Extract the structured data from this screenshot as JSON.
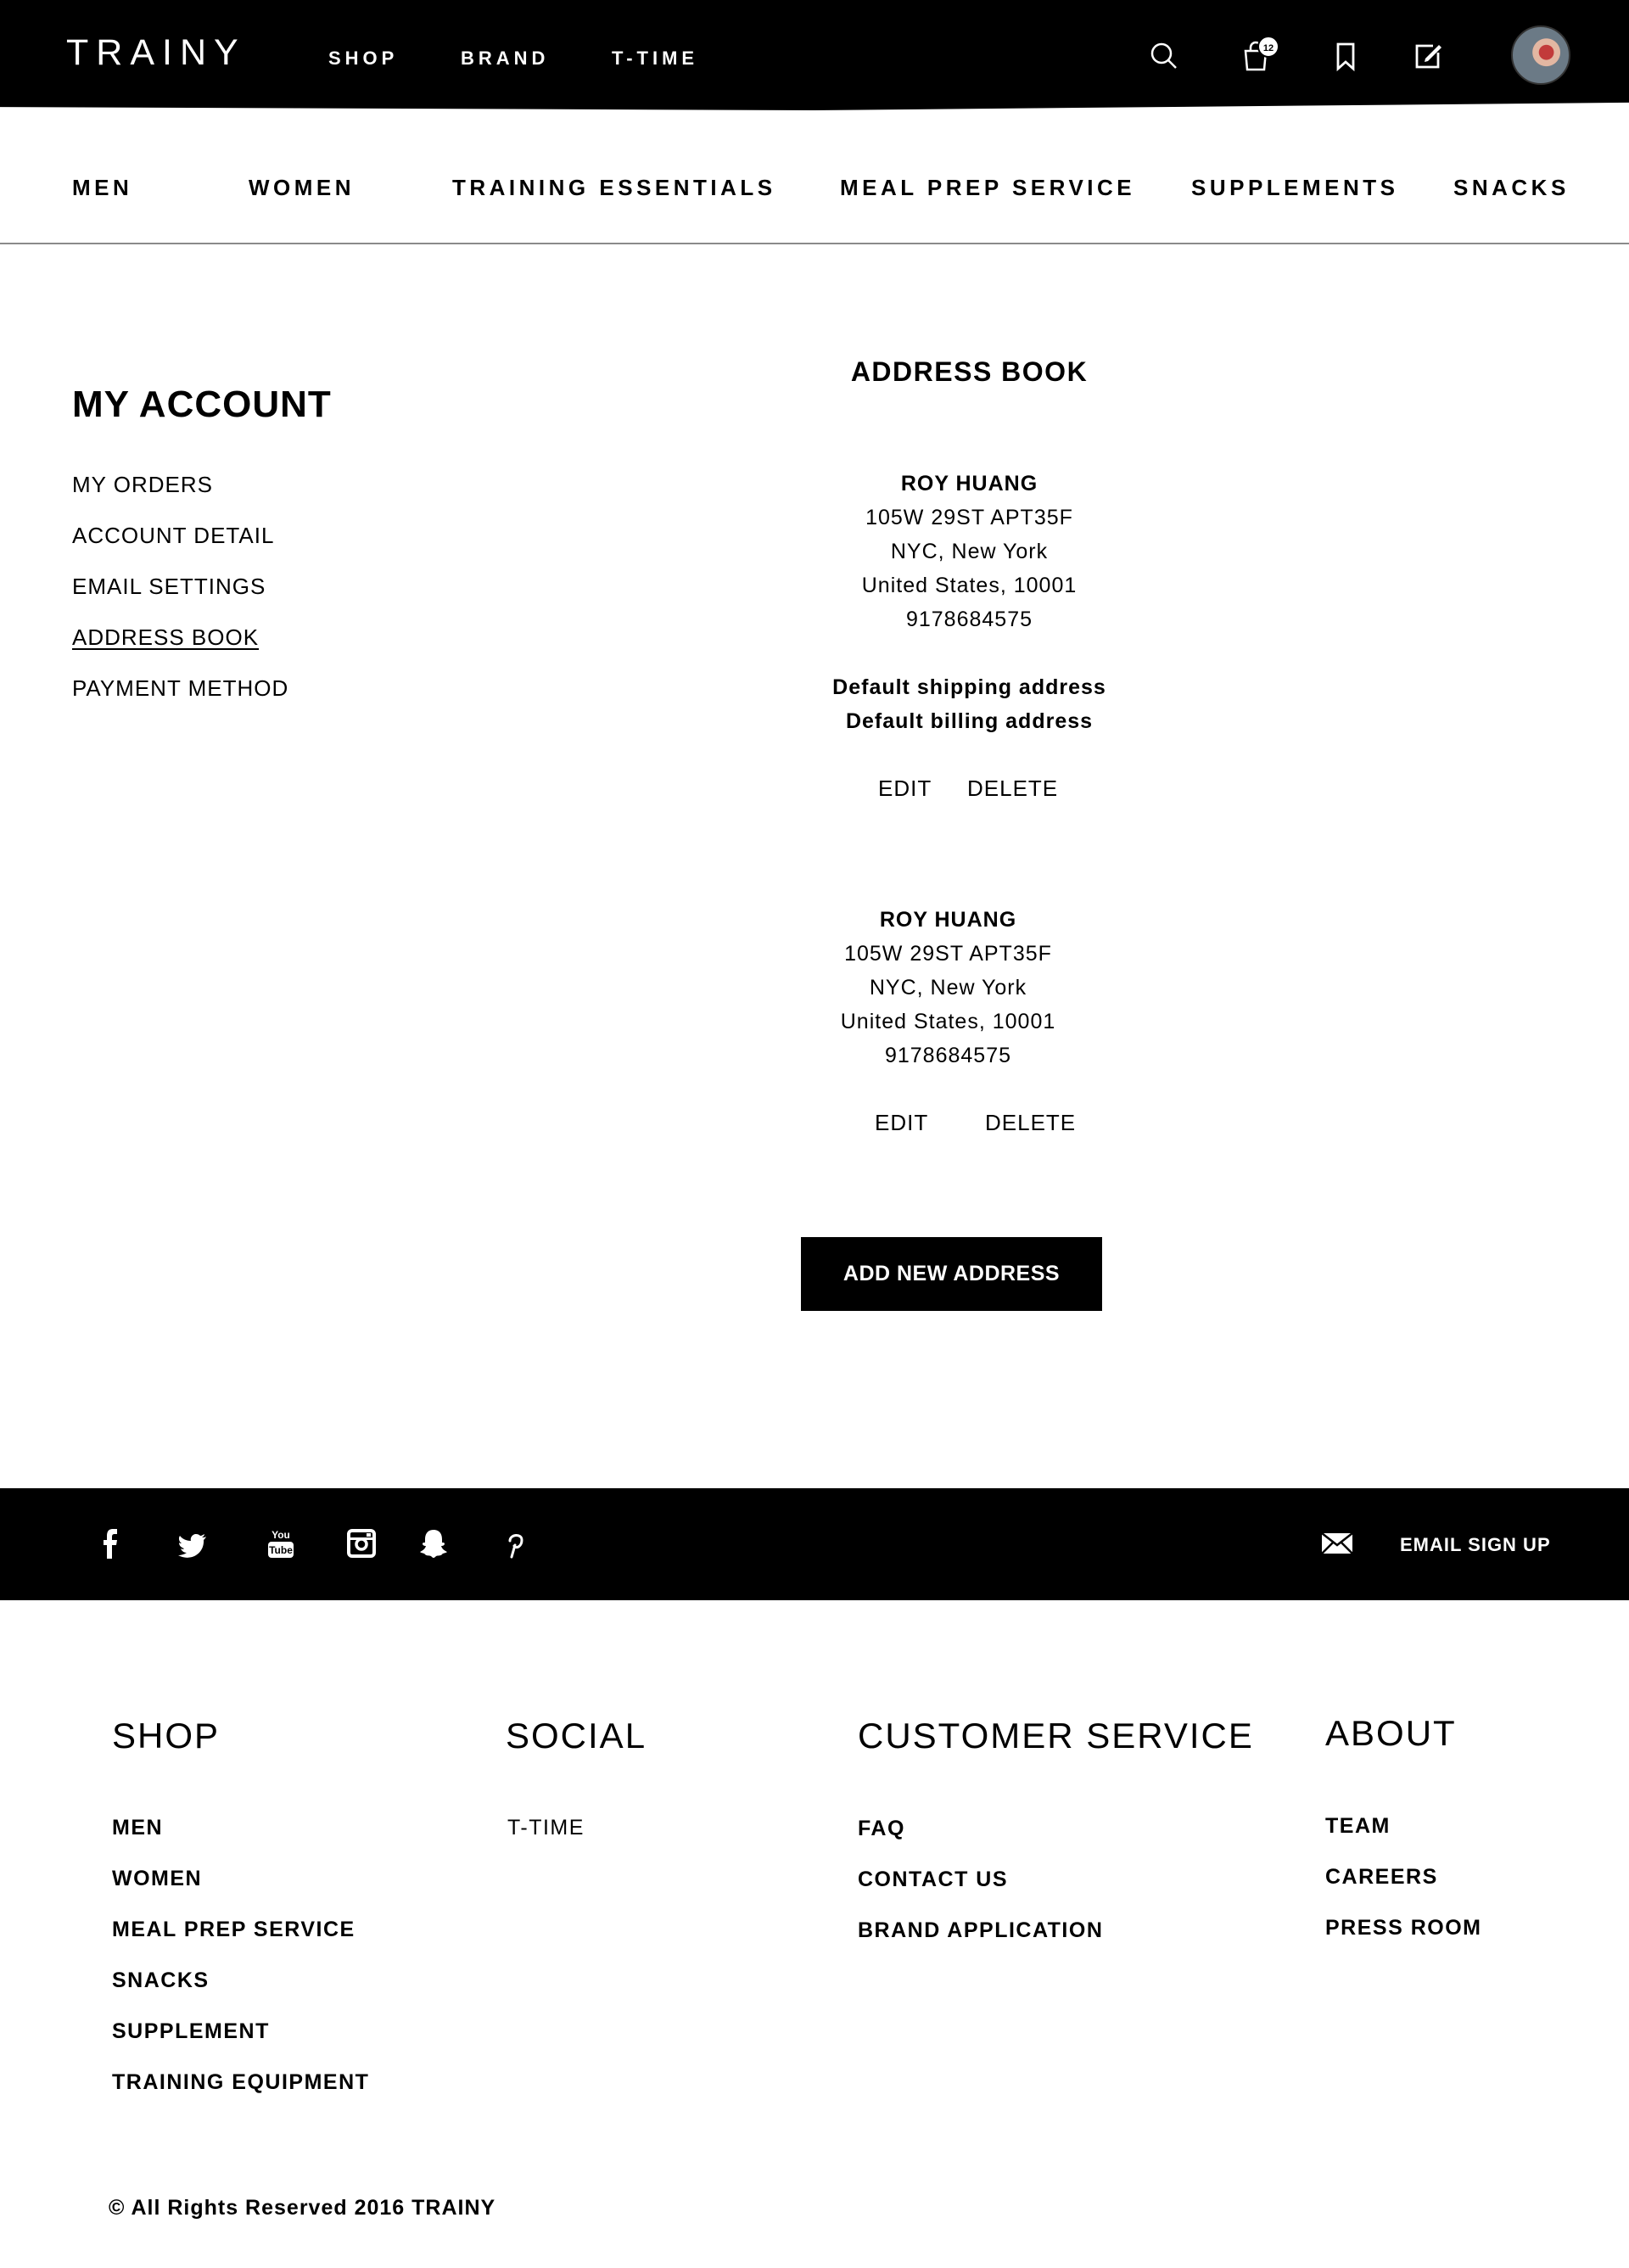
{
  "header": {
    "logo": "TRAINY",
    "nav": [
      "SHOP",
      "BRAND",
      "T-TIME"
    ],
    "cart_count": "12",
    "icons": [
      "search-icon",
      "cart-icon",
      "bookmark-icon",
      "edit-icon"
    ]
  },
  "categories": [
    "MEN",
    "WOMEN",
    "TRAINING ESSENTIALS",
    "MEAL PREP SERVICE",
    "SUPPLEMENTS",
    "SNACKS"
  ],
  "account": {
    "title": "MY ACCOUNT",
    "links": [
      "MY ORDERS",
      "ACCOUNT DETAIL",
      "EMAIL SETTINGS",
      "ADDRESS BOOK",
      "PAYMENT METHOD"
    ],
    "active": "ADDRESS BOOK"
  },
  "address_book": {
    "title": "ADDRESS BOOK",
    "addresses": [
      {
        "name": "ROY HUANG",
        "line1": "105W 29ST APT35F",
        "line2": "NYC, New York",
        "line3": "United States, 10001",
        "phone": "9178684575",
        "default_shipping": "Default shipping address",
        "default_billing": "Default billing address",
        "edit": "EDIT",
        "delete": "DELETE"
      },
      {
        "name": "ROY HUANG",
        "line1": "105W 29ST APT35F",
        "line2": "NYC, New York",
        "line3": "United States, 10001",
        "phone": "9178684575",
        "edit": "EDIT",
        "delete": "DELETE"
      }
    ],
    "add_button": "ADD NEW ADDRESS"
  },
  "social": {
    "icons": [
      "facebook-icon",
      "twitter-icon",
      "youtube-icon",
      "instagram-icon",
      "snapchat-icon",
      "pinterest-icon"
    ],
    "email_signup": "EMAIL SIGN UP"
  },
  "footer": {
    "columns": [
      {
        "title": "SHOP",
        "links": [
          "MEN",
          "WOMEN",
          "MEAL PREP SERVICE",
          "SNACKS",
          "SUPPLEMENT",
          "TRAINING EQUIPMENT"
        ]
      },
      {
        "title": "SOCIAL",
        "links": [
          "T-TIME"
        ]
      },
      {
        "title": "CUSTOMER SERVICE",
        "links": [
          "FAQ",
          "CONTACT US",
          "BRAND APPLICATION"
        ]
      },
      {
        "title": "ABOUT",
        "links": [
          "TEAM",
          "CAREERS",
          "PRESS ROOM"
        ]
      }
    ],
    "copyright": "© All Rights Reserved 2016 TRAINY"
  },
  "colors": {
    "primary": "#000000",
    "background": "#ffffff",
    "divider": "#8a8a8a"
  }
}
